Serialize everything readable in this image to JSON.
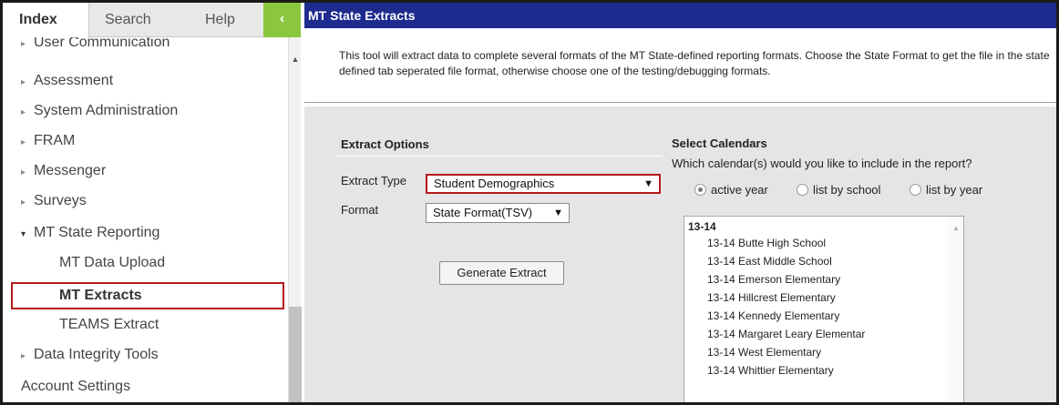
{
  "nav_tabs": {
    "index": "Index",
    "search": "Search",
    "help": "Help",
    "collapse": "‹"
  },
  "tree": {
    "items": [
      {
        "label": "User Communication",
        "arrow": "▸"
      },
      {
        "label": "Assessment",
        "arrow": "▸"
      },
      {
        "label": "System Administration",
        "arrow": "▸"
      },
      {
        "label": "FRAM",
        "arrow": "▸"
      },
      {
        "label": "Messenger",
        "arrow": "▸"
      },
      {
        "label": "Surveys",
        "arrow": "▸"
      },
      {
        "label": "MT State Reporting",
        "arrow": "▾"
      },
      {
        "label": "MT Data Upload"
      },
      {
        "label": "MT Extracts"
      },
      {
        "label": "TEAMS Extract"
      },
      {
        "label": "Data Integrity Tools",
        "arrow": "▸"
      },
      {
        "label": "Account Settings"
      }
    ],
    "scroll_up": "▲"
  },
  "main": {
    "title": "MT State Extracts",
    "description": "This tool will extract data to complete several formats of the MT State-defined reporting formats. Choose the State Format to get the file in the state defined tab seperated file format, otherwise choose one of the testing/debugging formats.",
    "extract_options": {
      "heading": "Extract Options",
      "type_label": "Extract Type",
      "type_value": "Student Demographics",
      "format_label": "Format",
      "format_value": "State Format(TSV)",
      "caret": "▼",
      "generate_button": "Generate Extract"
    },
    "calendars": {
      "heading": "Select Calendars",
      "question": "Which calendar(s) would you like to include in the report?",
      "radios": [
        {
          "label": "active year",
          "selected": true
        },
        {
          "label": "list by school",
          "selected": false
        },
        {
          "label": "list by year",
          "selected": false
        }
      ],
      "group": "13-14",
      "items": [
        "13-14 Butte High School",
        "13-14 East Middle School",
        "13-14 Emerson Elementary",
        "13-14 Hillcrest Elementary",
        "13-14 Kennedy Elementary",
        "13-14 Margaret Leary Elementar",
        "13-14 West Elementary",
        "13-14 Whittier Elementary"
      ],
      "scroll_up": "▲"
    }
  },
  "colors": {
    "title_bar": "#1d2b8e",
    "collapse_button": "#8cc63f",
    "highlight_border": "#b31b1b",
    "content_bg": "#e5e5e5"
  }
}
